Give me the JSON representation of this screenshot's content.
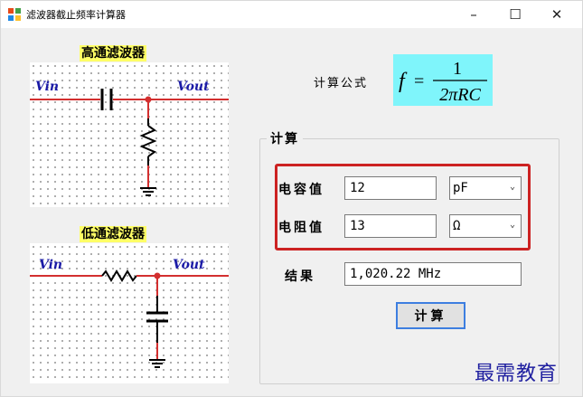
{
  "window": {
    "title": "滤波器截止频率计算器",
    "minimize_glyph": "–",
    "maximize_glyph": "☐",
    "close_glyph": "✕"
  },
  "high_pass": {
    "heading": "高通滤波器",
    "vin_label": "Vin",
    "vout_label": "Vout"
  },
  "low_pass": {
    "heading": "低通滤波器",
    "vin_label": "Vin",
    "vout_label": "Vout"
  },
  "formula": {
    "label": "计算公式",
    "lhs": "f",
    "equals": "=",
    "numerator": "1",
    "denominator": "2πRC"
  },
  "calc_group": {
    "legend": "计算",
    "capacitance_label": "电容值",
    "capacitance_value": "12",
    "capacitance_unit": "pF",
    "resistance_label": "电阻值",
    "resistance_value": "13",
    "resistance_unit": "Ω",
    "result_label": "结果",
    "result_value": "1,020.22 MHz",
    "calculate_button": "计算"
  },
  "watermark": "最需教育",
  "colors": {
    "wire_red": "#d32f2f",
    "label_blue": "#1a1aa6",
    "heading_yellow": "#ffff66",
    "formula_cyan": "#7ff5fb",
    "highlight_red": "#cc2222"
  }
}
